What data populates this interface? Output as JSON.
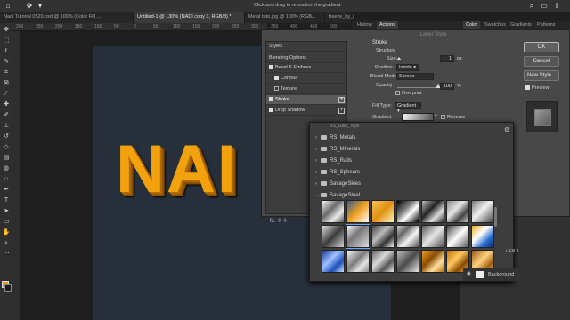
{
  "optbar": {
    "hint": "Click and drag to reposition the gradient."
  },
  "tabs": [
    {
      "label": "Nadi Tutorial 0520.psd @ 100% (Color Fill ...",
      "active": false
    },
    {
      "label": "Untitled-1 @ 130% (NADI copy 3, RGB/8) *",
      "active": true
    },
    {
      "label": "Metal tuto.jpg @ 100% (RGB...",
      "active": false
    },
    {
      "label": "freeze_by_i",
      "active": false
    }
  ],
  "ruler": [
    "260",
    "250",
    "200",
    "150",
    "100",
    "50",
    "0",
    "50",
    "100",
    "150",
    "200",
    "250",
    "300",
    "350",
    "400",
    "450",
    "500"
  ],
  "panels_left": [
    {
      "label": "History",
      "active": false
    },
    {
      "label": "Actions",
      "active": true
    }
  ],
  "panels_right": [
    {
      "label": "Color",
      "active": true
    },
    {
      "label": "Swatches",
      "active": false
    },
    {
      "label": "Gradients",
      "active": false
    },
    {
      "label": "Patterns",
      "active": false
    }
  ],
  "canvas_text": "NAI",
  "dialog": {
    "title": "Layer Style",
    "styles": [
      {
        "label": "Styles",
        "checkbox": false,
        "plus": false,
        "selected": false,
        "indent": false
      },
      {
        "label": "Blending Options",
        "checkbox": false,
        "plus": false,
        "selected": false,
        "indent": false
      },
      {
        "label": "Bevel & Emboss",
        "checkbox": true,
        "plus": false,
        "selected": false,
        "indent": false
      },
      {
        "label": "Contour",
        "checkbox": true,
        "plus": false,
        "selected": false,
        "indent": true
      },
      {
        "label": "Texture",
        "checkbox": true,
        "plus": false,
        "selected": false,
        "indent": true
      },
      {
        "label": "Stroke",
        "checkbox": true,
        "plus": true,
        "selected": true,
        "indent": false
      },
      {
        "label": "Drop Shadow",
        "checkbox": true,
        "plus": true,
        "selected": false,
        "indent": false
      }
    ],
    "fx": "fx.",
    "section": "Stroke",
    "subsection": "Structure",
    "size_label": "Size:",
    "size_value": "1",
    "size_unit": "px",
    "size_fraction": 0.05,
    "position_label": "Position:",
    "position_value": "Inside",
    "blend_label": "Blend Mode:",
    "blend_value": "Screen",
    "opacity_label": "Opacity:",
    "opacity_value": "100",
    "opacity_unit": "%",
    "opacity_fraction": 1.0,
    "overprint_label": "Overprint",
    "fill_type_label": "Fill Type:",
    "fill_type_value": "Gradient",
    "gradient_label": "Gradient:",
    "reverse_label": "Reverse",
    "ok": "OK",
    "cancel": "Cancel",
    "new_style": "New Style...",
    "preview_label": "Preview"
  },
  "picker": {
    "folders": [
      {
        "label": "RS_Metals",
        "open": false
      },
      {
        "label": "RS_Minerals",
        "open": false
      },
      {
        "label": "RS_Rails",
        "open": false
      },
      {
        "label": "RS_Sphears",
        "open": false
      },
      {
        "label": "SavageSkies",
        "open": false
      },
      {
        "label": "SavageSteel",
        "open": true
      }
    ],
    "clipped_top": "RS_Glas_Tops",
    "swatches": [
      "linear-gradient(135deg,#f5f5f5,#6a6a6a 40%,#eaeaea 70%,#555)",
      "linear-gradient(135deg,#3a5a8c,#f0a020 50%,#fff)",
      "linear-gradient(135deg,#f7c35a,#e09010 50%,#fff3c0)",
      "linear-gradient(135deg,#000,#888 40%,#fff 60%,#000)",
      "linear-gradient(135deg,#bbb,#222 40%,#ddd 70%,#333)",
      "linear-gradient(135deg,#8c8c8c,#e6e6e6 40%,#444 70%,#ccc)",
      "linear-gradient(135deg,#777,#f0f0f0 45%,#444)",
      "linear-gradient(135deg,#dcdcdc,#3a3a3a 50%,#cfcfcf)",
      "linear-gradient(135deg,#f8f8f8,#777 40%,#ddd)",
      "linear-gradient(135deg,#444,#bbb 40%,#333 70%,#eee)",
      "linear-gradient(135deg,#ccc,#666 30%,#f5f5f5 60%,#555)",
      "linear-gradient(135deg,#5a5a5a,#e6e6e6 50%,#555)",
      "linear-gradient(135deg,#444,#fff 50%,#555)",
      "linear-gradient(135deg,#e8b020,#fff 40%,#2b6fd0 70%,#0b2a70)",
      "linear-gradient(135deg,#1a3c9c,#9ec0ff 40%,#1d4fb8 70%,#cfe0ff)",
      "linear-gradient(135deg,#f4f4f4,#7a7a7a 45%,#e4e4e4 70%,#888)",
      "linear-gradient(135deg,#666,#dadada 40%,#555 70%,#eee)",
      "linear-gradient(135deg,#bdbdbd,#4a4a4a 50%,#e6e6e6)",
      "linear-gradient(135deg,#f0a020,#8a4a00 40%,#ffe0a0 70%,#c07000)",
      "linear-gradient(135deg,#c07000,#ffc860 40%,#8a4a00 70%,#f8b040)",
      "linear-gradient(135deg,#9a5a10,#ffd080 45%,#a06010 75%,#e8a030)"
    ]
  },
  "layer": {
    "label": "Background",
    "fill_label": "r Fill 1"
  }
}
